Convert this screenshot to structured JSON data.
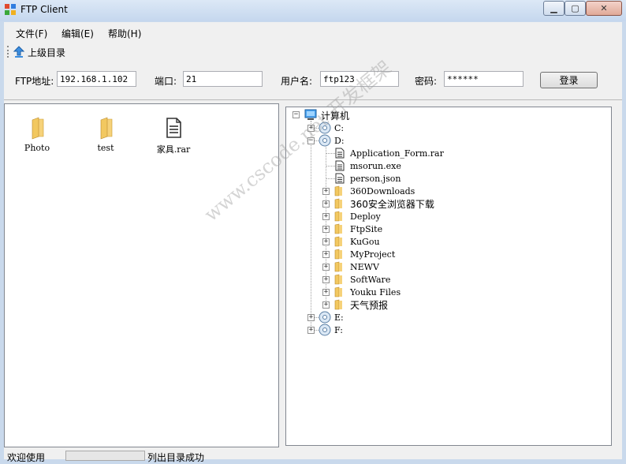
{
  "window": {
    "title": "FTP Client"
  },
  "menu": {
    "items": [
      "文件(F)",
      "编辑(E)",
      "帮助(H)"
    ]
  },
  "toolbar": {
    "up_label": "上级目录"
  },
  "connection": {
    "ftp_label": "FTP地址:",
    "ftp_value": "192.168.1.102",
    "port_label": "端口:",
    "port_value": "21",
    "user_label": "用户名:",
    "user_value": "ftp123",
    "pass_label": "密码:",
    "pass_value": "******",
    "login_label": "登录"
  },
  "remote_files": [
    {
      "name": "Photo",
      "icon": "folder-icon"
    },
    {
      "name": "test",
      "icon": "folder-icon"
    },
    {
      "name": "家具.rar",
      "icon": "file-icon"
    }
  ],
  "tree": {
    "root": "计算机",
    "drives": [
      "C:",
      "D:",
      "E:",
      "F:"
    ],
    "d_files": [
      "Application_Form.rar",
      "msorun.exe",
      "person.json"
    ],
    "d_folders": [
      "360Downloads",
      "360安全浏览器下载",
      "Deploy",
      "FtpSite",
      "KuGou",
      "MyProject",
      "NEWV",
      "SoftWare",
      "Youku Files",
      "天气预报"
    ]
  },
  "status": {
    "welcome": "欢迎使用",
    "message": "列出目录成功"
  },
  "watermark": "www.cscode.net 开发框架",
  "colors": {
    "accent": "#c9d9ec",
    "folder": "#f2c14e"
  }
}
